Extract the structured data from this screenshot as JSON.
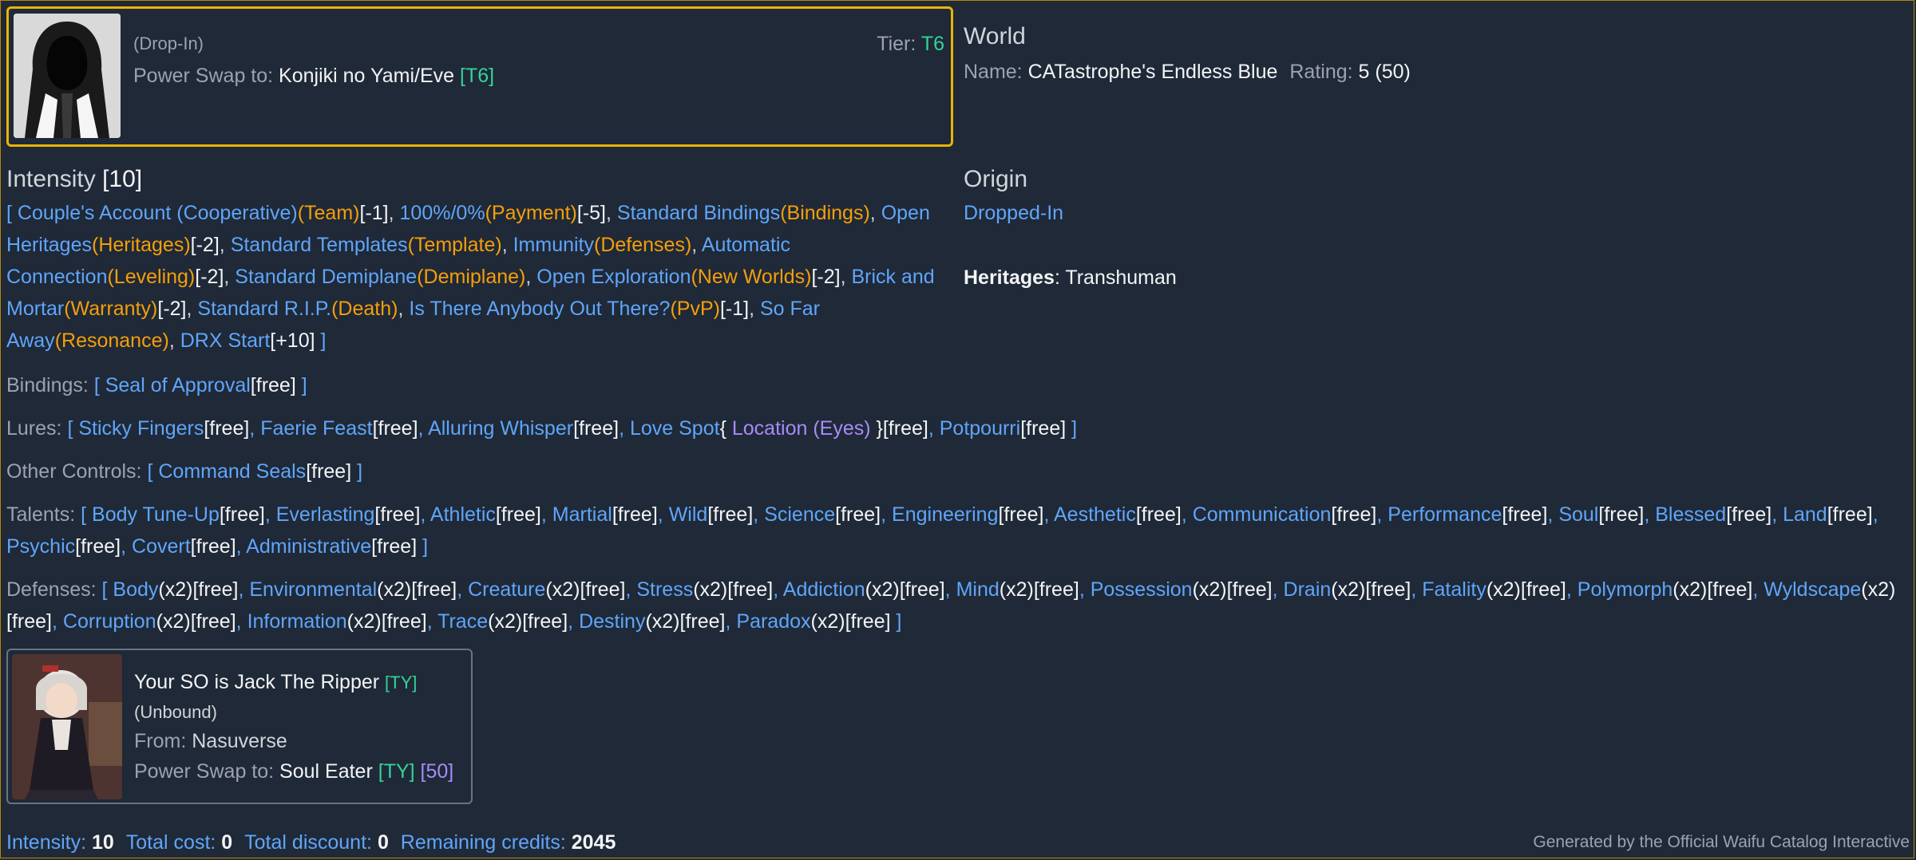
{
  "drop_in_card": {
    "kind": "(Drop-In)",
    "tier_label": "Tier:",
    "tier_value": "T6",
    "swap_label": "Power Swap to:",
    "swap_target": "Konjiki no Yami/Eve",
    "swap_tier": "[T6]",
    "avatar_icon": "hooded-figure-icon"
  },
  "world": {
    "heading": "World",
    "name_label": "Name:",
    "name_value": "CATastrophe's Endless Blue",
    "rating_label": "Rating:",
    "rating_value": "5",
    "rating_extra": "(50)"
  },
  "intensity": {
    "heading": "Intensity",
    "value": "[10]",
    "open": "[",
    "close": "]",
    "items": [
      {
        "name": "Couple's Account (Cooperative)",
        "cat": "(Team)",
        "cost": "[-1]"
      },
      {
        "name": "100%/0%",
        "cat": "(Payment)",
        "cost": "[-5]"
      },
      {
        "name": "Standard Bindings",
        "cat": "(Bindings)",
        "cost": ""
      },
      {
        "name": "Open Heritages",
        "cat": "(Heritages)",
        "cost": "[-2]"
      },
      {
        "name": "Standard Templates",
        "cat": "(Template)",
        "cost": ""
      },
      {
        "name": "Immunity",
        "cat": "(Defenses)",
        "cost": ""
      },
      {
        "name": "Automatic Connection",
        "cat": "(Leveling)",
        "cost": "[-2]"
      },
      {
        "name": "Standard Demiplane",
        "cat": "(Demiplane)",
        "cost": ""
      },
      {
        "name": "Open Exploration",
        "cat": "(New Worlds)",
        "cost": "[-2]"
      },
      {
        "name": "Brick and Mortar",
        "cat": "(Warranty)",
        "cost": "[-2]"
      },
      {
        "name": "Standard R.I.P.",
        "cat": "(Death)",
        "cost": ""
      },
      {
        "name": "Is There Anybody Out There?",
        "cat": "(PvP)",
        "cost": "[-1]"
      },
      {
        "name": "So Far Away",
        "cat": "(Resonance)",
        "cost": ""
      },
      {
        "name": "DRX Start",
        "cat": "",
        "cost": "[+10]"
      }
    ]
  },
  "origin": {
    "heading": "Origin",
    "value": "Dropped-In",
    "heritages_label": "Heritages",
    "heritages_value": ": Transhuman"
  },
  "bindings": {
    "label": "Bindings:",
    "items": [
      {
        "name": "Seal of Approval",
        "cost": "[free]"
      }
    ]
  },
  "lures": {
    "label": "Lures:",
    "items": [
      {
        "name": "Sticky Fingers",
        "cost": "[free]"
      },
      {
        "name": "Faerie Feast",
        "cost": "[free]"
      },
      {
        "name": "Alluring Whisper",
        "cost": "[free]"
      },
      {
        "name": "Love Spot",
        "extra_open": "{ ",
        "extra": "Location (Eyes)",
        "extra_close": " }",
        "cost": "[free]"
      },
      {
        "name": "Potpourri",
        "cost": "[free]"
      }
    ]
  },
  "other_controls": {
    "label": "Other Controls:",
    "items": [
      {
        "name": "Command Seals",
        "cost": "[free]"
      }
    ]
  },
  "talents": {
    "label": "Talents:",
    "items": [
      {
        "name": "Body Tune-Up",
        "cost": "[free]"
      },
      {
        "name": "Everlasting",
        "cost": "[free]"
      },
      {
        "name": "Athletic",
        "cost": "[free]"
      },
      {
        "name": "Martial",
        "cost": "[free]"
      },
      {
        "name": "Wild",
        "cost": "[free]"
      },
      {
        "name": "Science",
        "cost": "[free]"
      },
      {
        "name": "Engineering",
        "cost": "[free]"
      },
      {
        "name": "Aesthetic",
        "cost": "[free]"
      },
      {
        "name": "Communication",
        "cost": "[free]"
      },
      {
        "name": "Performance",
        "cost": "[free]"
      },
      {
        "name": "Soul",
        "cost": "[free]"
      },
      {
        "name": "Blessed",
        "cost": "[free]"
      },
      {
        "name": "Land",
        "cost": "[free]"
      },
      {
        "name": "Psychic",
        "cost": "[free]"
      },
      {
        "name": "Covert",
        "cost": "[free]"
      },
      {
        "name": "Administrative",
        "cost": "[free]"
      }
    ]
  },
  "defenses": {
    "label": "Defenses:",
    "items": [
      {
        "name": "Body",
        "mult": "(x2)",
        "cost": "[free]"
      },
      {
        "name": "Environmental",
        "mult": "(x2)",
        "cost": "[free]"
      },
      {
        "name": "Creature",
        "mult": "(x2)",
        "cost": "[free]"
      },
      {
        "name": "Stress",
        "mult": "(x2)",
        "cost": "[free]"
      },
      {
        "name": "Addiction",
        "mult": "(x2)",
        "cost": "[free]"
      },
      {
        "name": "Mind",
        "mult": "(x2)",
        "cost": "[free]"
      },
      {
        "name": "Possession",
        "mult": "(x2)",
        "cost": "[free]"
      },
      {
        "name": "Drain",
        "mult": "(x2)",
        "cost": "[free]"
      },
      {
        "name": "Fatality",
        "mult": "(x2)",
        "cost": "[free]"
      },
      {
        "name": "Polymorph",
        "mult": "(x2)",
        "cost": "[free]"
      },
      {
        "name": "Wyldscape",
        "mult": "(x2)",
        "cost": "[free]"
      },
      {
        "name": "Corruption",
        "mult": "(x2)",
        "cost": "[free]"
      },
      {
        "name": "Information",
        "mult": "(x2)",
        "cost": "[free]"
      },
      {
        "name": "Trace",
        "mult": "(x2)",
        "cost": "[free]"
      },
      {
        "name": "Destiny",
        "mult": "(x2)",
        "cost": "[free]"
      },
      {
        "name": "Paradox",
        "mult": "(x2)",
        "cost": "[free]"
      }
    ]
  },
  "so_card": {
    "title": "Your SO is Jack The Ripper",
    "tier": "[TY]",
    "bound": "(Unbound)",
    "from_label": "From:",
    "from_value": "Nasuverse",
    "swap_label": "Power Swap to:",
    "swap_target": "Soul Eater",
    "swap_tier": "[TY]",
    "swap_extra": "[50]",
    "avatar_icon": "anime-character-portrait"
  },
  "footer": {
    "intensity_label": "Intensity:",
    "intensity_value": "10",
    "cost_label": "Total cost:",
    "cost_value": "0",
    "discount_label": "Total discount:",
    "discount_value": "0",
    "credits_label": "Remaining credits:",
    "credits_value": "2045",
    "credit_text": "Generated by the Official Waifu Catalog Interactive"
  },
  "colors": {
    "background": "#1f2937",
    "link": "#60a5fa",
    "category": "#f59e0b",
    "tier": "#34d399",
    "accent_border": "#eab308"
  }
}
